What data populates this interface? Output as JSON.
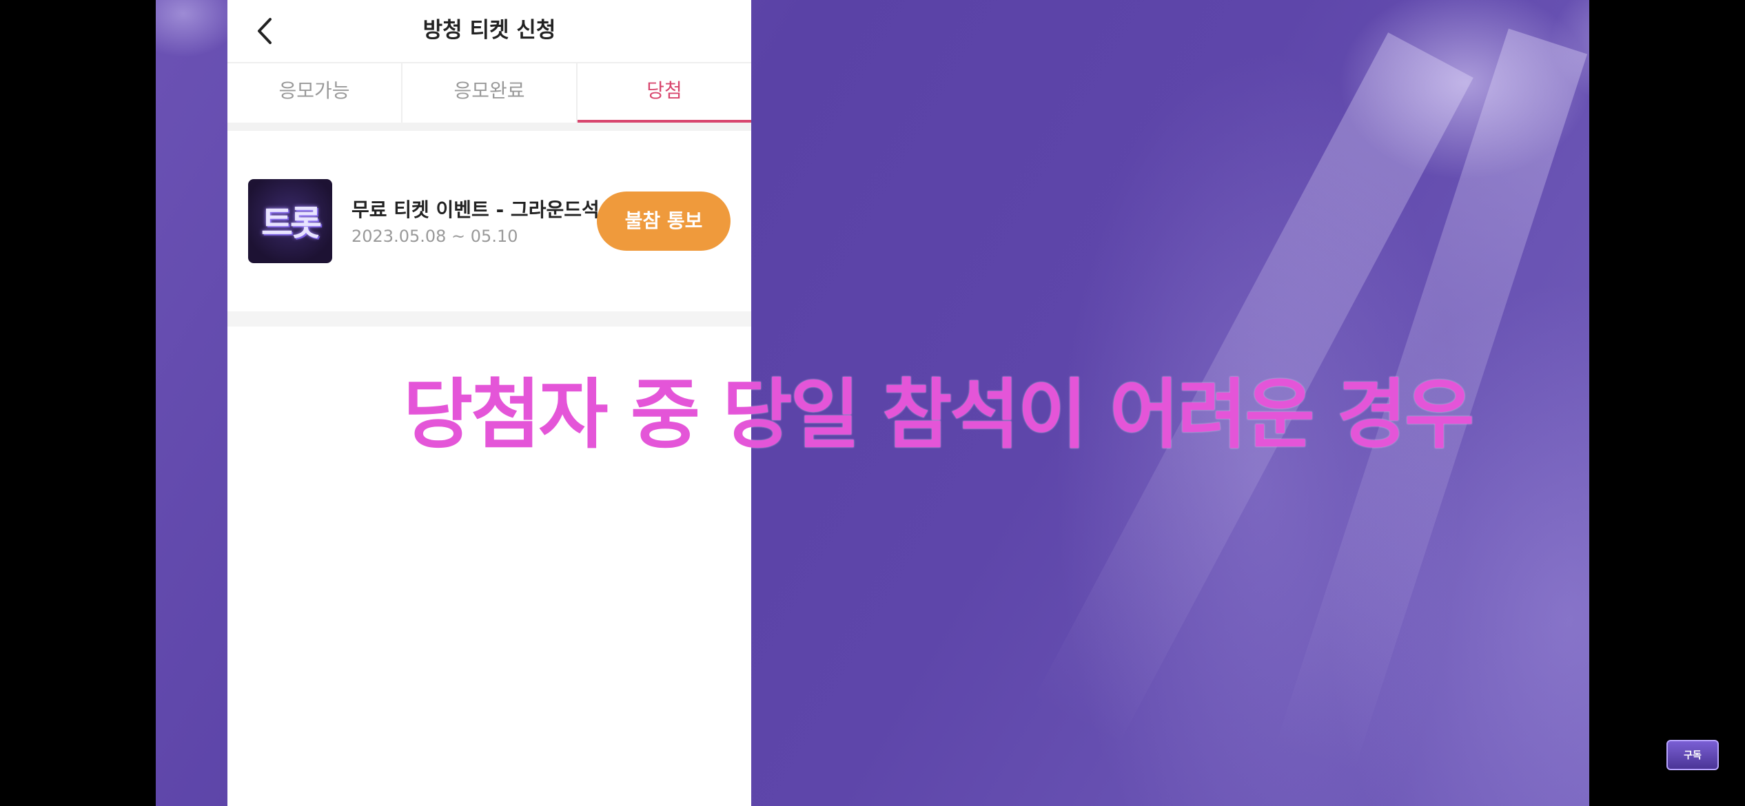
{
  "header": {
    "title": "방청 티켓 신청"
  },
  "tabs": [
    {
      "label": "응모가능",
      "active": false
    },
    {
      "label": "응모완료",
      "active": false
    },
    {
      "label": "당첨",
      "active": true
    }
  ],
  "item": {
    "thumbnail_text": "트롯",
    "title": "무료 티켓 이벤트 - 그라운드석",
    "date": "2023.05.08 ~ 05.10",
    "button_label": "불참 통보"
  },
  "caption": "당첨자 중 당일 참석이 어려운 경우",
  "subscribe": {
    "label": "구독"
  },
  "colors": {
    "accent": "#d8466e",
    "button": "#ef9a3c",
    "caption": "#e455d8"
  }
}
